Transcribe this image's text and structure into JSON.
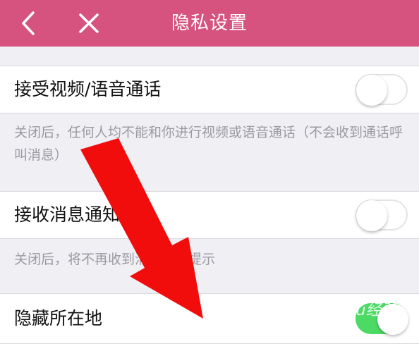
{
  "header": {
    "title": "隐私设置",
    "back_icon": "chevron-left-icon",
    "close_icon": "close-icon",
    "background": "#d6527f"
  },
  "settings": [
    {
      "label": "接受视频/语音通话",
      "enabled": false,
      "description": "关闭后，任何人均不能和你进行视频或语音通话（不会收到通话呼叫消息）"
    },
    {
      "label": "接收消息通知",
      "enabled": false,
      "description": "关闭后，将不再收到消息通知提示"
    },
    {
      "label": "隐藏所在地",
      "enabled": true
    }
  ],
  "watermark": {
    "text": "Baidu经验"
  },
  "colors": {
    "arrow": "#f20d0d",
    "toggle_on": "#4cd964"
  }
}
